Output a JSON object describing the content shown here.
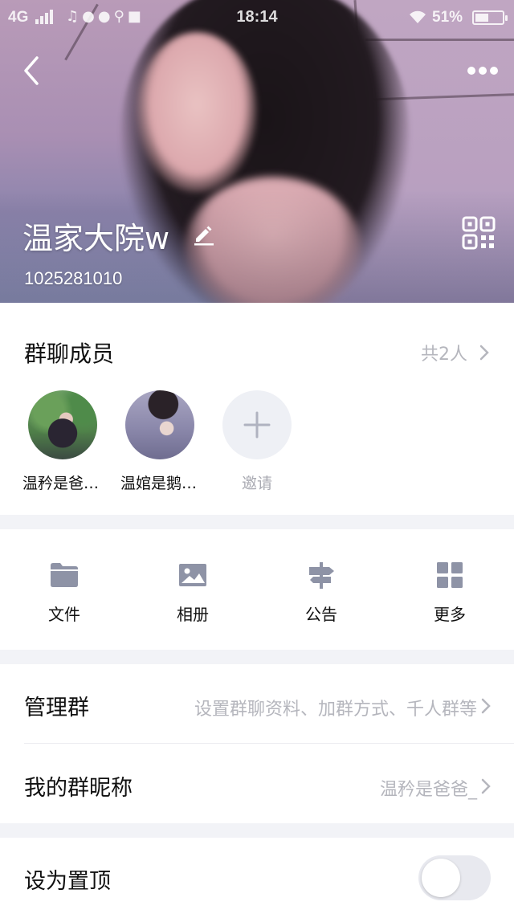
{
  "status_bar": {
    "network": "4G",
    "time": "18:14",
    "battery": "51%",
    "battery_level": 0.51,
    "notification_icons": [
      "music-icon",
      "chat-bubble-icon",
      "message-icon",
      "search-icon",
      "lock-icon"
    ]
  },
  "header": {
    "group_name": "温家大院w",
    "group_id": "1025281010",
    "back_icon": "chevron-left-icon",
    "more_icon": "more-dots-icon",
    "qr_icon": "qr-code-icon",
    "edit_icon": "pencil-icon"
  },
  "members": {
    "title": "群聊成员",
    "count_label": "共2人",
    "list": [
      {
        "name": "温矜是爸…"
      },
      {
        "name": "温婠是鹅…"
      }
    ],
    "invite_label": "邀请"
  },
  "tools": [
    {
      "label": "文件",
      "icon": "folder-icon"
    },
    {
      "label": "相册",
      "icon": "image-icon"
    },
    {
      "label": "公告",
      "icon": "signpost-icon"
    },
    {
      "label": "更多",
      "icon": "grid-icon"
    }
  ],
  "settings": {
    "manage": {
      "title": "管理群",
      "value": "设置群聊资料、加群方式、千人群等"
    },
    "nickname": {
      "title": "我的群昵称",
      "value": "温矜是爸爸_"
    },
    "pin": {
      "title": "设为置顶",
      "enabled": false
    }
  },
  "colors": {
    "secondary_text": "#b5b6bd",
    "icon_gray": "#8e93a6",
    "background": "#f2f3f7"
  }
}
